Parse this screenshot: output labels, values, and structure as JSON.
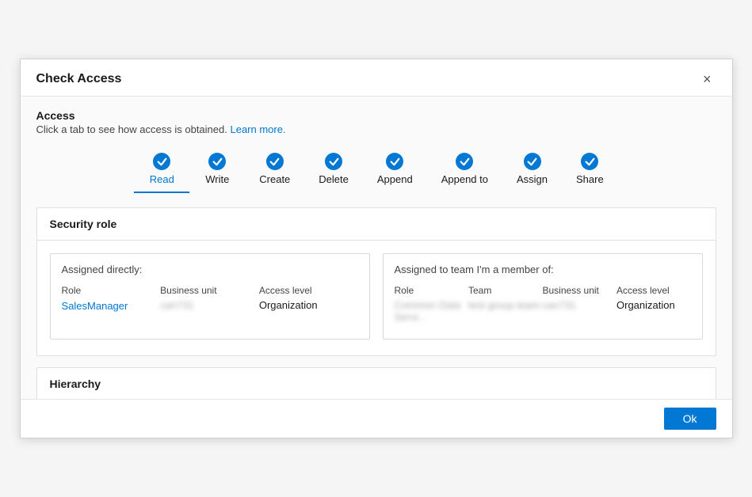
{
  "dialog": {
    "title": "Check Access",
    "close_label": "×"
  },
  "access": {
    "heading": "Access",
    "subtext": "Click a tab to see how access is obtained.",
    "learn_more": "Learn more."
  },
  "tabs": [
    {
      "id": "read",
      "label": "Read",
      "active": true
    },
    {
      "id": "write",
      "label": "Write",
      "active": false
    },
    {
      "id": "create",
      "label": "Create",
      "active": false
    },
    {
      "id": "delete",
      "label": "Delete",
      "active": false
    },
    {
      "id": "append",
      "label": "Append",
      "active": false
    },
    {
      "id": "append_to",
      "label": "Append to",
      "active": false
    },
    {
      "id": "assign",
      "label": "Assign",
      "active": false
    },
    {
      "id": "share",
      "label": "Share",
      "active": false
    }
  ],
  "security_role": {
    "section_label": "Security role",
    "direct": {
      "label": "Assigned directly:",
      "columns": [
        "Role",
        "Business unit",
        "Access level"
      ],
      "row": {
        "role_part1": "Sales",
        "role_part2": "Manager",
        "business_unit": "can731",
        "access_level": "Organization"
      }
    },
    "team": {
      "label": "Assigned to team I'm a member of:",
      "columns": [
        "Role",
        "Team",
        "Business unit",
        "Access level"
      ],
      "row": {
        "role": "Common Data Servi...",
        "team": "test group team",
        "business_unit": "can731",
        "access_level": "Organization"
      }
    }
  },
  "hierarchy": {
    "label": "Hierarchy"
  },
  "footer": {
    "ok_label": "Ok"
  }
}
